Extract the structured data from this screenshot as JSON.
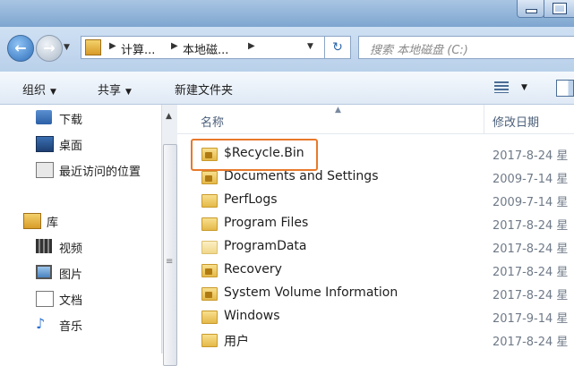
{
  "window": {
    "minimize_label": "",
    "maximize_label": ""
  },
  "address": {
    "crumbs": [
      "计算...",
      "本地磁..."
    ],
    "search_placeholder": "搜索 本地磁盘 (C:)",
    "refresh_glyph": "↻"
  },
  "toolbar": {
    "organize": "组织",
    "share": "共享",
    "new_folder": "新建文件夹"
  },
  "nav": {
    "favorites": [
      {
        "label": "下载",
        "icon": "downloads-icon"
      },
      {
        "label": "桌面",
        "icon": "desktop-icon"
      },
      {
        "label": "最近访问的位置",
        "icon": "recent-places-icon"
      }
    ],
    "library_label": "库",
    "libraries": [
      {
        "label": "视频",
        "icon": "video-icon"
      },
      {
        "label": "图片",
        "icon": "pictures-icon"
      },
      {
        "label": "文档",
        "icon": "documents-icon"
      },
      {
        "label": "音乐",
        "icon": "music-icon"
      }
    ]
  },
  "files": {
    "columns": {
      "name": "名称",
      "date": "修改日期"
    },
    "rows": [
      {
        "name": "$Recycle.Bin",
        "date": "2017-8-24 星",
        "locked": true,
        "highlighted": true
      },
      {
        "name": "Documents and Settings",
        "date": "2009-7-14 星",
        "locked": true
      },
      {
        "name": "PerfLogs",
        "date": "2009-7-14 星",
        "locked": false
      },
      {
        "name": "Program Files",
        "date": "2017-8-24 星",
        "locked": false
      },
      {
        "name": "ProgramData",
        "date": "2017-8-24 星",
        "locked": false,
        "pale": true
      },
      {
        "name": "Recovery",
        "date": "2017-8-24 星",
        "locked": true
      },
      {
        "name": "System Volume Information",
        "date": "2017-8-24 星",
        "locked": true
      },
      {
        "name": "Windows",
        "date": "2017-9-14 星",
        "locked": false
      },
      {
        "name": "用户",
        "date": "2017-8-24 星",
        "locked": false
      }
    ]
  },
  "colors": {
    "highlight": "#e8792b",
    "accent": "#2f6fba"
  }
}
